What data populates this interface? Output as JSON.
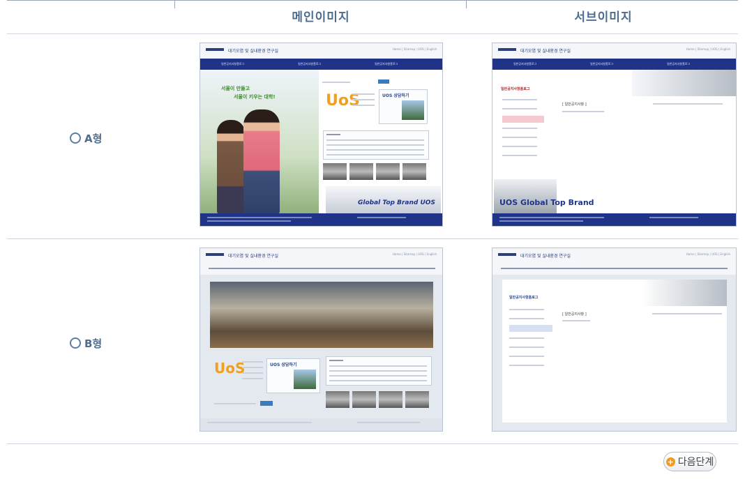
{
  "header": {
    "main_image_label": "메인이미지",
    "sub_image_label": "서브이미지"
  },
  "options": [
    {
      "label": "A형",
      "main_thumb": {
        "site_title": "대기오염 및 실내환경 연구실",
        "nav": [
          "일반공지사항홈로그",
          "일반공지사항홈로그",
          "일반공지사항홈로그"
        ],
        "slogan1": "서울이 만들고",
        "slogan2": "서울이 키우는 대학!",
        "uos_box": "UOS 상담하기",
        "brand": "Global Top Brand UOS"
      },
      "sub_thumb": {
        "site_title": "대기오염 및 실내환경 연구실",
        "side_title": "일반공지사항홈로그",
        "content_title": "[ 일반공지사항 ]",
        "brand": "UOS Global Top Brand"
      }
    },
    {
      "label": "B형",
      "main_thumb": {
        "site_title": "대기오염 및 실내환경 연구실",
        "uos_box": "UOS 상담하기"
      },
      "sub_thumb": {
        "site_title": "대기오염 및 실내환경 연구실",
        "side_title": "일반공지사항홈로그",
        "content_title": "[ 일반공지사항 ]"
      }
    }
  ],
  "next_button": {
    "label": "다음단계",
    "icon": "plus-icon"
  }
}
